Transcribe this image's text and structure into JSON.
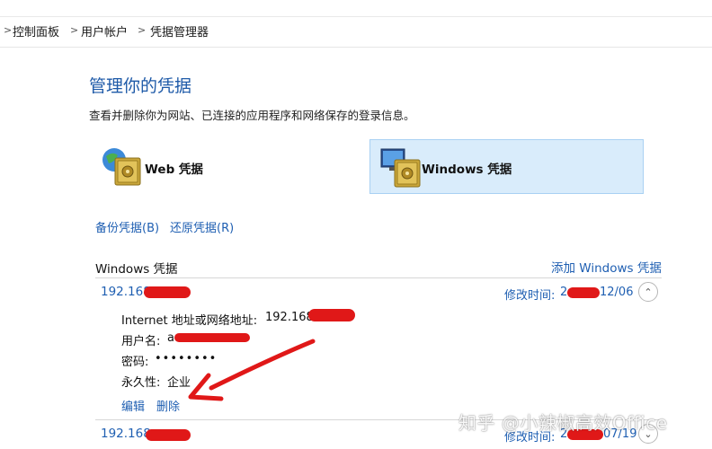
{
  "breadcrumb": {
    "items": [
      "控制面板",
      "用户帐户",
      "凭据管理器"
    ],
    "separator": ">"
  },
  "main": {
    "title": "管理你的凭据",
    "description": "查看并删除你为网站、已连接的应用程序和网络保存的登录信息。"
  },
  "tiles": {
    "web": {
      "label": "Web 凭据",
      "icon": "globe-vault-icon"
    },
    "windows": {
      "label": "Windows 凭据",
      "icon": "monitor-vault-icon",
      "selected": true
    }
  },
  "actions": {
    "backup": "备份凭据(B)",
    "restore": "还原凭据(R)"
  },
  "section": {
    "heading": "Windows 凭据",
    "add_link": "添加 Windows 凭据"
  },
  "entries": [
    {
      "name": "192.168",
      "modified_label": "修改时间:",
      "modified_value_fragment": "2",
      "modified_value_tail": "12/06",
      "expanded": true,
      "details": {
        "address_label": "Internet 地址或网络地址:",
        "address_value": "192.168",
        "username_label": "用户名:",
        "username_value": "a",
        "password_label": "密码:",
        "password_value": "••••••••",
        "persistence_label": "永久性:",
        "persistence_value": "企业"
      },
      "edit_link": "编辑",
      "delete_link": "删除"
    },
    {
      "name": "192.168",
      "modified_label": "修改时间:",
      "modified_value_fragment": "2",
      "modified_value_tail": "07/19",
      "expanded": false
    }
  ],
  "watermark": "知乎 @小辣椒高效Office",
  "colors": {
    "link_blue": "#1f5fb2",
    "selected_tile": "#d9ecfb",
    "annotation_red": "#e01818"
  }
}
